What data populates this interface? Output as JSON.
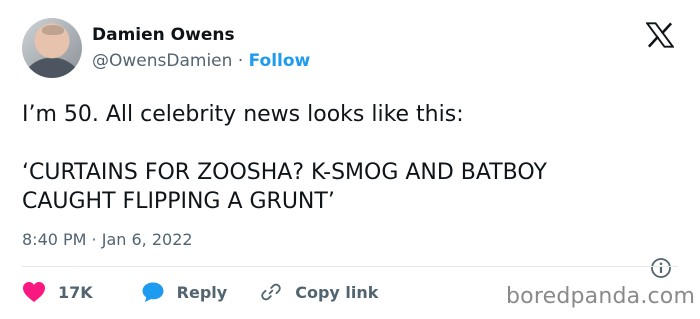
{
  "author": {
    "name": "Damien Owens",
    "handle": "@OwensDamien",
    "separator": "·",
    "follow_label": "Follow"
  },
  "tweet": {
    "line1": "I’m 50. All celebrity news looks like this:",
    "line2": "‘CURTAINS FOR ZOOSHA? K-SMOG AND BATBOY",
    "line3": "CAUGHT FLIPPING A GRUNT’"
  },
  "timestamp": "8:40 PM · Jan 6, 2022",
  "actions": {
    "likes_count": "17K",
    "reply_label": "Reply",
    "copy_label": "Copy link"
  },
  "icons": {
    "logo": "x-logo-icon",
    "like": "heart-icon",
    "reply": "speech-bubble-icon",
    "copy": "link-icon",
    "info": "info-icon"
  },
  "colors": {
    "follow": "#1d9bf0",
    "heart": "#f91880",
    "reply_bubble": "#1d9bf0",
    "text": "#0f1419",
    "muted": "#536471"
  },
  "watermark": "boredpanda.com"
}
